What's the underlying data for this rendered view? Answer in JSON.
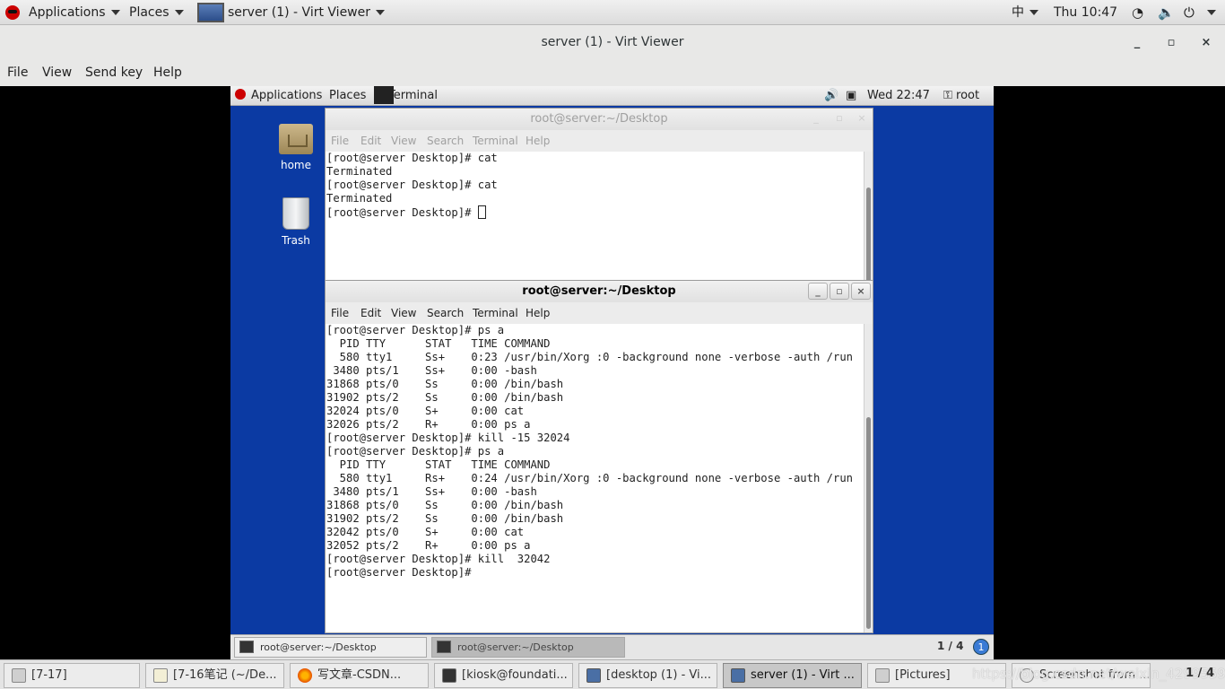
{
  "host_topbar": {
    "applications": "Applications",
    "places": "Places",
    "window": "server (1) - Virt Viewer",
    "input_method": "中",
    "clock": "Thu 10:47"
  },
  "virt_viewer": {
    "title": "server (1) - Virt Viewer",
    "controls": {
      "minimize": "_",
      "maximize": "▫",
      "close": "×"
    },
    "menu": [
      "File",
      "View",
      "Send key",
      "Help"
    ]
  },
  "guest": {
    "topbar": {
      "applications": "Applications",
      "places": "Places",
      "terminal": "Terminal",
      "clock": "Wed 22:47",
      "user": "root"
    },
    "desktop_icons": [
      "home",
      "Trash"
    ],
    "term_back": {
      "title": "root@server:~/Desktop",
      "menu": [
        "File",
        "Edit",
        "View",
        "Search",
        "Terminal",
        "Help"
      ],
      "lines": [
        "[root@server Desktop]# cat",
        "Terminated",
        "[root@server Desktop]# cat",
        "Terminated",
        "[root@server Desktop]# "
      ]
    },
    "term_front": {
      "title": "root@server:~/Desktop",
      "menu": [
        "File",
        "Edit",
        "View",
        "Search",
        "Terminal",
        "Help"
      ],
      "lines": [
        "[root@server Desktop]# ps a",
        "  PID TTY      STAT   TIME COMMAND",
        "  580 tty1     Ss+    0:23 /usr/bin/Xorg :0 -background none -verbose -auth /run",
        " 3480 pts/1    Ss+    0:00 -bash",
        "31868 pts/0    Ss     0:00 /bin/bash",
        "31902 pts/2    Ss     0:00 /bin/bash",
        "32024 pts/0    S+     0:00 cat",
        "32026 pts/2    R+     0:00 ps a",
        "[root@server Desktop]# kill -15 32024",
        "[root@server Desktop]# ps a",
        "  PID TTY      STAT   TIME COMMAND",
        "  580 tty1     Rs+    0:24 /usr/bin/Xorg :0 -background none -verbose -auth /run",
        " 3480 pts/1    Ss+    0:00 -bash",
        "31868 pts/0    Ss     0:00 /bin/bash",
        "31902 pts/2    Ss     0:00 /bin/bash",
        "32042 pts/0    S+     0:00 cat",
        "32052 pts/2    R+     0:00 ps a",
        "[root@server Desktop]# kill  32042",
        "[root@server Desktop]# "
      ]
    },
    "taskbar": {
      "items": [
        "root@server:~/Desktop",
        "root@server:~/Desktop"
      ],
      "pager": "1 / 4",
      "badge": "1"
    }
  },
  "host_taskbar": {
    "items": [
      "[7-17]",
      "[7-16笔记 (~/De...",
      "写文章-CSDN...",
      "[kiosk@foundati...",
      "[desktop (1) - Vi...",
      "server (1) - Virt ...",
      "[Pictures]",
      "Screenshot from ..."
    ],
    "watermark": "https://blog.csdn.net/weixin_42995591",
    "pager": "1 / 4"
  }
}
